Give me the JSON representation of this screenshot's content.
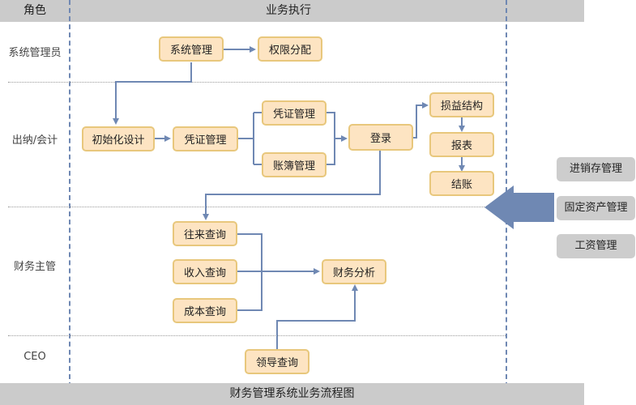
{
  "header": {
    "role_label": "角色",
    "execution_label": "业务执行"
  },
  "footer": {
    "title": "财务管理系统业务流程图"
  },
  "roles": [
    "系统管理员",
    "出纳/会计",
    "财务主管",
    "CEO"
  ],
  "nodes": {
    "sys_manage": "系统管理",
    "permission": "权限分配",
    "init_design": "初始化设计",
    "voucher_main": "凭证管理",
    "voucher_sub": "凭证管理",
    "ledger": "账簿管理",
    "login": "登录",
    "profit_loss": "损益结构",
    "report": "报表",
    "closing": "结账",
    "ar_ap_query": "往来查询",
    "income_query": "收入查询",
    "cost_query": "成本查询",
    "finance_analysis": "财务分析",
    "leader_query": "领导查询"
  },
  "external_modules": [
    "进销存管理",
    "固定资产管理",
    "工资管理"
  ],
  "colors": {
    "node_fill": "#fde4c2",
    "node_border": "#e8c77c",
    "connector": "#6f88b3",
    "band": "#cbcbcb"
  }
}
